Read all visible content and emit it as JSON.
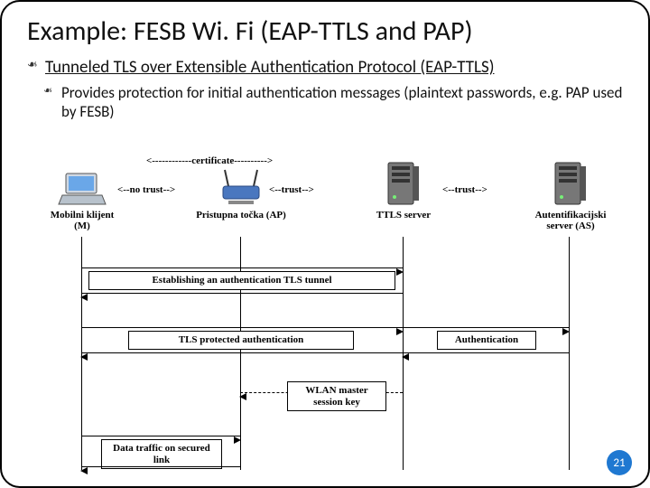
{
  "title": "Example: FESB Wi. Fi (EAP-TTLS and PAP)",
  "bullet1": "Tunneled TLS over Extensible Authentication Protocol (EAP-TTLS)",
  "bullet2": "Provides protection for initial authentication messages (plaintext passwords, e.g. PAP used by FESB)",
  "trust": {
    "cert": "<------------certificate---------->",
    "noTrust": "<--no trust-->",
    "trust1": "<--trust-->",
    "trust2": "<--trust-->"
  },
  "nodes": {
    "client": "Mobilni klijent (M)",
    "ap": "Pristupna točka (AP)",
    "ttls": "TTLS server",
    "as": "Autentifikacijski server (AS)"
  },
  "boxes": {
    "establish": "Establishing an authentication TLS tunnel",
    "protected": "TLS protected authentication",
    "auth": "Authentication",
    "wlanKey": "WLAN master session key",
    "traffic": "Data traffic on secured link"
  },
  "pageNumber": "21"
}
